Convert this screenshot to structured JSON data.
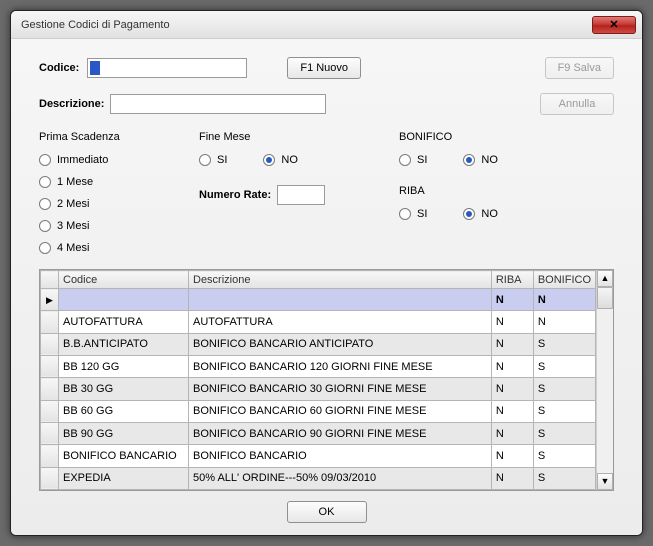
{
  "window": {
    "title": "Gestione Codici di Pagamento"
  },
  "form": {
    "codice_label": "Codice:",
    "descrizione_label": "Descrizione:",
    "f1_nuovo": "F1  Nuovo",
    "f9_salva": "F9  Salva",
    "annulla": "Annulla",
    "ok": "OK"
  },
  "prima_scadenza": {
    "title": "Prima Scadenza",
    "options": [
      "Immediato",
      "1 Mese",
      "2 Mesi",
      "3 Mesi",
      "4 Mesi"
    ]
  },
  "fine_mese": {
    "title": "Fine Mese",
    "si": "SI",
    "no": "NO"
  },
  "numero_rate": {
    "label": "Numero Rate:"
  },
  "bonifico": {
    "title": "BONIFICO",
    "si": "SI",
    "no": "NO"
  },
  "riba": {
    "title": "RIBA",
    "si": "SI",
    "no": "NO"
  },
  "grid": {
    "headers": {
      "codice": "Codice",
      "descrizione": "Descrizione",
      "riba": "RIBA",
      "bonifico": "BONIFICO"
    },
    "rows": [
      {
        "codice": "",
        "descrizione": "",
        "riba": "N",
        "bonifico": "N"
      },
      {
        "codice": "AUTOFATTURA",
        "descrizione": "AUTOFATTURA",
        "riba": "N",
        "bonifico": "N"
      },
      {
        "codice": "B.B.ANTICIPATO",
        "descrizione": "BONIFICO BANCARIO ANTICIPATO",
        "riba": "N",
        "bonifico": "S"
      },
      {
        "codice": "BB 120 GG",
        "descrizione": "BONIFICO BANCARIO 120 GIORNI FINE MESE",
        "riba": "N",
        "bonifico": "S"
      },
      {
        "codice": "BB 30 GG",
        "descrizione": "BONIFICO BANCARIO 30 GIORNI FINE MESE",
        "riba": "N",
        "bonifico": "S"
      },
      {
        "codice": "BB 60 GG",
        "descrizione": "BONIFICO BANCARIO 60 GIORNI FINE MESE",
        "riba": "N",
        "bonifico": "S"
      },
      {
        "codice": "BB 90 GG",
        "descrizione": "BONIFICO BANCARIO 90 GIORNI FINE MESE",
        "riba": "N",
        "bonifico": "S"
      },
      {
        "codice": "BONIFICO BANCARIO",
        "descrizione": "BONIFICO BANCARIO",
        "riba": "N",
        "bonifico": "S"
      },
      {
        "codice": "EXPEDIA",
        "descrizione": "50% ALL' ORDINE---50% 09/03/2010",
        "riba": "N",
        "bonifico": "S"
      }
    ]
  }
}
